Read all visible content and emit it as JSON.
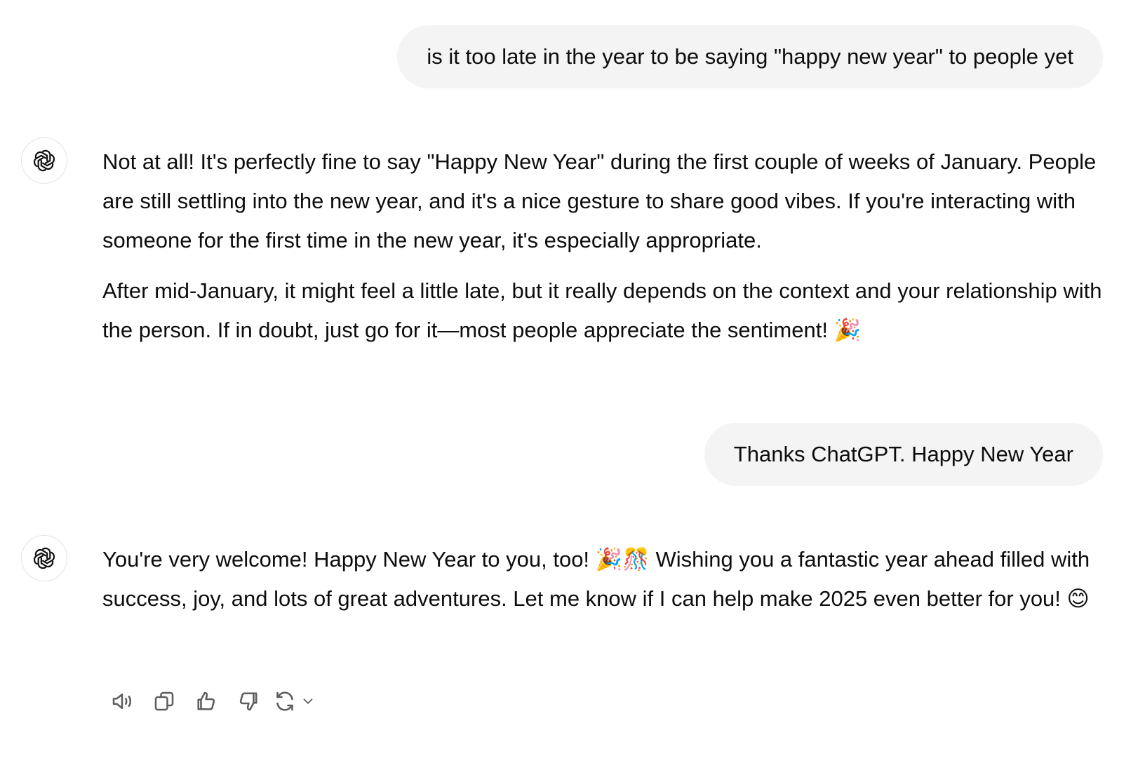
{
  "conversation": {
    "user_message_1": "is it too late in the year to be saying \"happy new year\" to people yet",
    "assistant_message_1": {
      "paragraph_1": "Not at all! It's perfectly fine to say \"Happy New Year\" during the first couple of weeks of January. People are still settling into the new year, and it's a nice gesture to share good vibes. If you're interacting with someone for the first time in the new year, it's especially appropriate.",
      "paragraph_2": "After mid-January, it might feel a little late, but it really depends on the context and your relationship with the person. If in doubt, just go for it—most people appreciate the sentiment! 🎉"
    },
    "user_message_2": "Thanks ChatGPT. Happy New Year",
    "assistant_message_2": {
      "paragraph_1": "You're very welcome! Happy New Year to you, too! 🎉🎊 Wishing you a fantastic year ahead filled with success, joy, and lots of great adventures. Let me know if I can help make 2025 even better for you! 😊"
    }
  },
  "icons": {
    "avatar": "openai-logo-icon",
    "read_aloud": "speaker-icon",
    "copy": "copy-icon",
    "thumbs_up": "thumbs-up-icon",
    "thumbs_down": "thumbs-down-icon",
    "regenerate": "refresh-icon",
    "regenerate_menu": "chevron-down-icon"
  },
  "colors": {
    "user_bubble_bg": "#f4f4f4",
    "text": "#0d0d0d",
    "icon": "#5d5d5d",
    "avatar_border": "#e3e3e3"
  }
}
